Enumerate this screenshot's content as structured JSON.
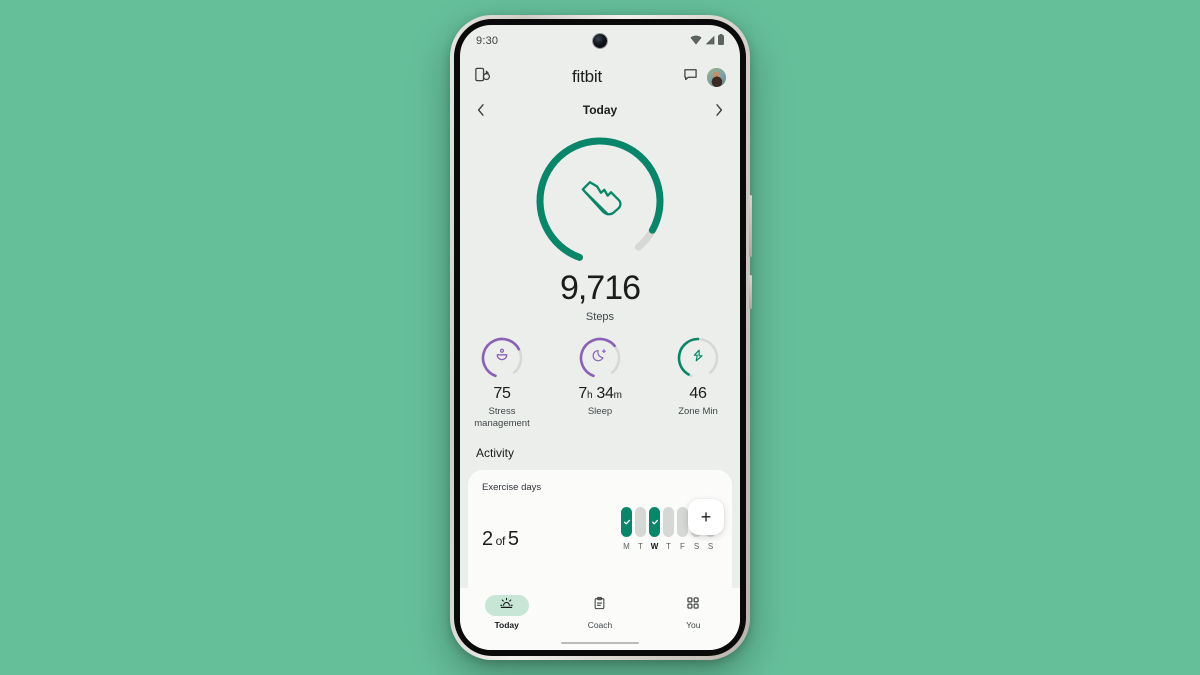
{
  "theme": {
    "page_bg": "#65c09a",
    "screen_bg": "#eceeeb",
    "card_bg": "#fbfbfa",
    "accent_green": "#09866a",
    "accent_purple": "#8a62b5",
    "track_gray": "#d6d8d6",
    "active_nav_pill": "#c8e6d5",
    "text_primary": "#1b1c1b",
    "text_secondary": "#41474a"
  },
  "status_bar": {
    "time": "9:30",
    "icons": [
      "wifi-icon",
      "cellular-signal-icon",
      "battery-icon"
    ]
  },
  "app_bar": {
    "left_icon": "device-sync-icon",
    "title": "fitbit",
    "chat_icon": "chat-bubble-icon",
    "avatar": "user-avatar"
  },
  "date_nav": {
    "prev_icon": "chevron-left-icon",
    "label": "Today",
    "next_icon": "chevron-right-icon"
  },
  "hero": {
    "icon": "running-shoe-icon",
    "value": "9,716",
    "label": "Steps",
    "progress_percent": 93,
    "ring_color": "#09866a",
    "track_color": "#d6d8d6"
  },
  "metrics": [
    {
      "icon": "stress-bowl-icon",
      "value": "75",
      "unit": "",
      "label": "Stress\nmanagement",
      "label_line1": "Stress",
      "label_line2": "management",
      "progress_percent": 74,
      "color": "#8a62b5"
    },
    {
      "icon": "moon-sparkle-icon",
      "value": "7",
      "unit": "h",
      "value2": "34",
      "unit2": "m",
      "label_line1": "Sleep",
      "label_line2": "",
      "progress_percent": 70,
      "color": "#8a62b5"
    },
    {
      "icon": "zone-minutes-bolt-icon",
      "value": "46",
      "unit": "",
      "label_line1": "Zone Min",
      "label_line2": "",
      "progress_percent": 50,
      "color": "#09866a"
    }
  ],
  "activity": {
    "section_title": "Activity",
    "card_title": "Exercise days",
    "count_value": "2",
    "count_middle": "of",
    "count_goal": "5",
    "add_button_icon": "plus-icon",
    "add_button_label": "+",
    "days": [
      {
        "label": "M",
        "completed": true,
        "is_today": false
      },
      {
        "label": "T",
        "completed": false,
        "is_today": false
      },
      {
        "label": "W",
        "completed": true,
        "is_today": true
      },
      {
        "label": "T",
        "completed": false,
        "is_today": false
      },
      {
        "label": "F",
        "completed": false,
        "is_today": false
      },
      {
        "label": "S",
        "completed": false,
        "is_today": false
      },
      {
        "label": "S",
        "completed": false,
        "is_today": false
      }
    ]
  },
  "bottom_nav": [
    {
      "icon": "sunrise-icon",
      "label": "Today",
      "active": true
    },
    {
      "icon": "clipboard-icon",
      "label": "Coach",
      "active": false
    },
    {
      "icon": "grid-squares-icon",
      "label": "You",
      "active": false
    }
  ]
}
